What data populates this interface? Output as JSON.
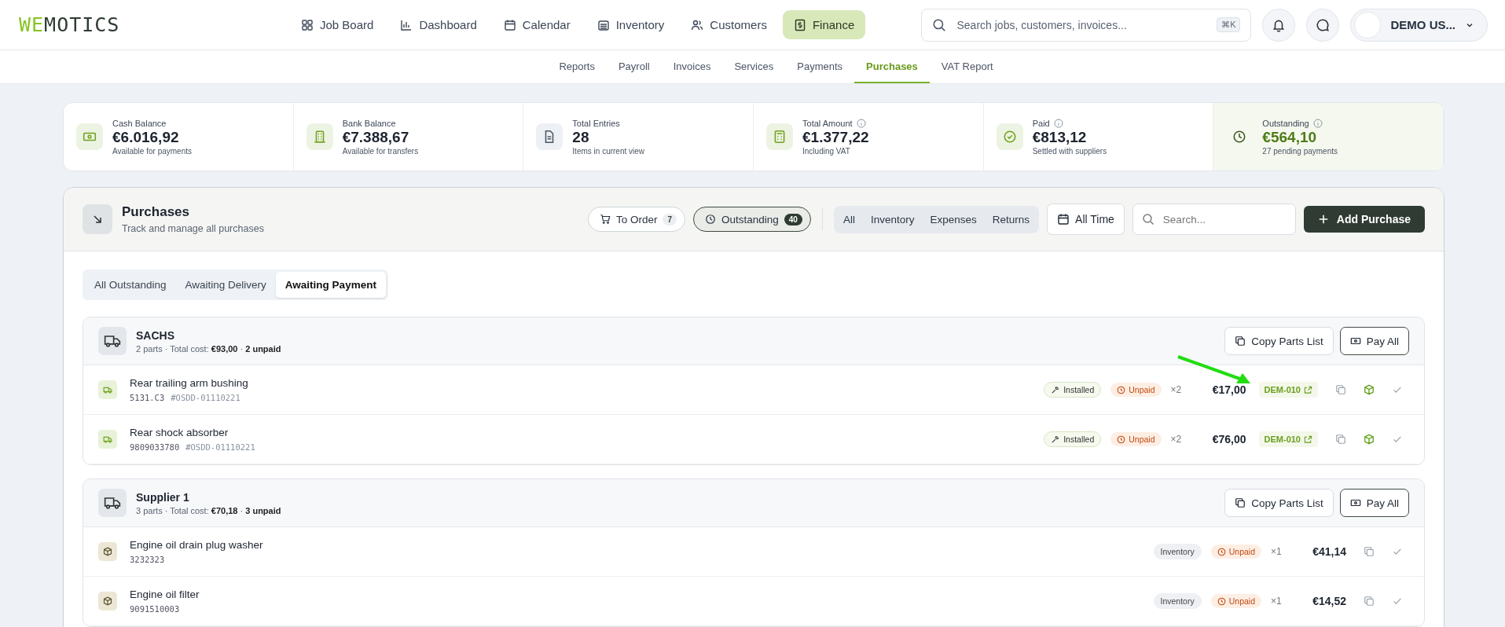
{
  "logo": {
    "accent": "WE",
    "rest": "MOTICS"
  },
  "nav": [
    {
      "label": "Job Board",
      "kind": "grid",
      "selected": false
    },
    {
      "label": "Dashboard",
      "kind": "bars",
      "selected": false
    },
    {
      "label": "Calendar",
      "kind": "calendar",
      "selected": false
    },
    {
      "label": "Inventory",
      "kind": "store",
      "selected": false
    },
    {
      "label": "Customers",
      "kind": "users",
      "selected": false
    },
    {
      "label": "Finance",
      "kind": "money",
      "selected": true
    }
  ],
  "search": {
    "placeholder": "Search jobs, customers, invoices...",
    "shortcut": "⌘K"
  },
  "user": {
    "name": "DEMO US..."
  },
  "subnav": [
    {
      "label": "Reports",
      "selected": false
    },
    {
      "label": "Payroll",
      "selected": false
    },
    {
      "label": "Invoices",
      "selected": false
    },
    {
      "label": "Services",
      "selected": false
    },
    {
      "label": "Payments",
      "selected": false
    },
    {
      "label": "Purchases",
      "selected": true
    },
    {
      "label": "VAT Report",
      "selected": false
    }
  ],
  "stats": [
    {
      "kind": "cash",
      "label": "Cash Balance",
      "value": "€6.016,92",
      "note": "Available for payments",
      "info": false,
      "highlighted": false
    },
    {
      "kind": "bank",
      "label": "Bank Balance",
      "value": "€7.388,67",
      "note": "Available for transfers",
      "info": false,
      "highlighted": false
    },
    {
      "kind": "doc",
      "label": "Total Entries",
      "value": "28",
      "note": "Items in current view",
      "info": false,
      "highlighted": false
    },
    {
      "kind": "calc",
      "label": "Total Amount",
      "value": "€1.377,22",
      "note": "Including VAT",
      "info": true,
      "highlighted": false
    },
    {
      "kind": "check",
      "label": "Paid",
      "value": "€813,12",
      "note": "Settled with suppliers",
      "info": true,
      "highlighted": false
    },
    {
      "kind": "clock",
      "label": "Outstanding",
      "value": "€564,10",
      "note": "27 pending payments",
      "info": true,
      "highlighted": true
    }
  ],
  "panel": {
    "title": "Purchases",
    "subtitle": "Track and manage all purchases",
    "chips": [
      {
        "label": "To Order",
        "count": "7",
        "kind": "cart",
        "selected": false
      },
      {
        "label": "Outstanding",
        "count": "40",
        "kind": "clock",
        "selected": true
      }
    ],
    "filters": [
      "All",
      "Inventory",
      "Expenses",
      "Returns"
    ],
    "period": "All Time",
    "search_placeholder": "Search...",
    "add": "Add Purchase"
  },
  "tabs": [
    {
      "label": "All Outstanding",
      "selected": false
    },
    {
      "label": "Awaiting Delivery",
      "selected": false
    },
    {
      "label": "Awaiting Payment",
      "selected": true
    }
  ],
  "groups": [
    {
      "name": "SACHS",
      "summary": "2 parts · Total cost: **€93,00** · **2 unpaid**",
      "copy": "Copy Parts List",
      "pay": "Pay All",
      "items": [
        {
          "kind": "delivery",
          "name": "Rear trailing arm bushing",
          "code": "5131.C3",
          "order": "#OSDD-01110221",
          "tag": {
            "kind": "installed",
            "label": "Installed"
          },
          "status": "Unpaid",
          "qty": "×2",
          "price": "€17,00",
          "ref": "DEM-010"
        },
        {
          "kind": "delivery",
          "name": "Rear shock absorber",
          "code": "9809033780",
          "order": "#OSDD-01110221",
          "tag": {
            "kind": "installed",
            "label": "Installed"
          },
          "status": "Unpaid",
          "qty": "×2",
          "price": "€76,00",
          "ref": "DEM-010"
        }
      ]
    },
    {
      "name": "Supplier 1",
      "summary": "3 parts · Total cost: **€70,18** · **3 unpaid**",
      "copy": "Copy Parts List",
      "pay": "Pay All",
      "items": [
        {
          "kind": "stock",
          "name": "Engine oil drain plug washer",
          "code": "3232323",
          "tag": {
            "kind": "inventory",
            "label": "Inventory"
          },
          "status": "Unpaid",
          "qty": "×1",
          "price": "€41,14"
        },
        {
          "kind": "stock",
          "name": "Engine oil filter",
          "code": "9091510003",
          "tag": {
            "kind": "inventory",
            "label": "Inventory"
          },
          "status": "Unpaid",
          "qty": "×1",
          "price": "€14,52"
        }
      ]
    }
  ]
}
